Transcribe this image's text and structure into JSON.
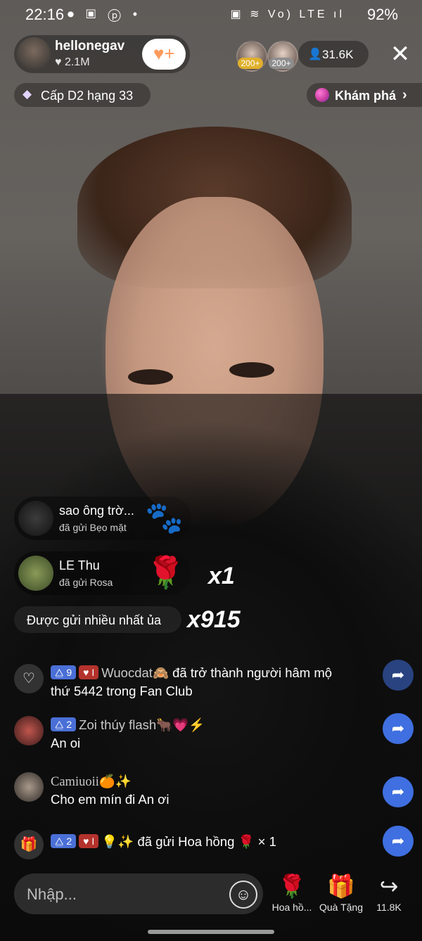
{
  "status_bar": {
    "time": "22:16",
    "left_icons": "⏺ ▣ ⓟ •",
    "right_icons": "▣ ≋ Vo) LTE ıl",
    "battery": "92%"
  },
  "host": {
    "name": "hellonegav",
    "likes": "2.1M"
  },
  "top_viewers": [
    {
      "badge": "200+",
      "color": "#e0b02b"
    },
    {
      "badge": "200+",
      "color": "#8e8e8e"
    }
  ],
  "viewer_count": "31.6K",
  "level": "Cấp D2 hạng 33",
  "explore": "Khám phá",
  "gift_banners": [
    {
      "name": "sao ông trờ...",
      "sub": "đã gửi Bẹo mặt",
      "gift": "🐾",
      "combo": ""
    },
    {
      "name": "LE Thu",
      "sub": "đã gửi Rosa",
      "gift": "🌹",
      "combo": "x1"
    }
  ],
  "most_sent": {
    "label": "Được gửi nhiều nhất ủa",
    "combo": "x915"
  },
  "chat": [
    {
      "tags": [
        "⧋ 9",
        "♥ I"
      ],
      "user": "Wuocdat🙈",
      "line1_rest": " đã trở thành người hâm mộ",
      "line2": "thứ 5442 trong Fan Club"
    },
    {
      "tags": [
        "⧋ 2"
      ],
      "user": "Zoi thúy flash🐂💗⚡",
      "line1_rest": "",
      "line2": "An oi"
    },
    {
      "tags": [],
      "user": "Camiuoii🍊✨",
      "line1_rest": "",
      "line2": "Cho em mín đi An ơi"
    },
    {
      "tags": [
        "⧋ 2",
        "♥ I"
      ],
      "user": "💡✨",
      "line1_rest": " đã gửi Hoa hồng 🌹 × 1",
      "line2": ""
    }
  ],
  "input": {
    "placeholder": "Nhập..."
  },
  "actions": [
    {
      "label": "Hoa hồ...",
      "icon": "🌹"
    },
    {
      "label": "Quà Tặng",
      "icon": "🎁"
    },
    {
      "label": "11.8K",
      "icon": "↪"
    }
  ]
}
